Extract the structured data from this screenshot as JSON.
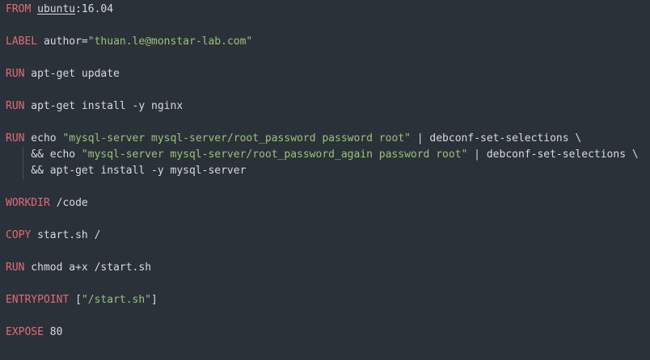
{
  "code": {
    "lines": [
      {
        "kw": "FROM",
        "image": "ubuntu",
        "tag": ":16.04"
      },
      {
        "kw": "LABEL",
        "key": " author=",
        "value": "\"thuan.le@monstar-lab.com\""
      },
      {
        "kw": "RUN",
        "text": " apt-get update"
      },
      {
        "kw": "RUN",
        "text": " apt-get install -y nginx"
      },
      {
        "kw": "RUN",
        "pre": " echo ",
        "str": "\"mysql-server mysql-server/root_password password root\"",
        "post": " | debconf-set-selections \\"
      },
      {
        "pre": "    && echo ",
        "str": "\"mysql-server mysql-server/root_password_again password root\"",
        "post": " | debconf-set-selections \\"
      },
      {
        "text": "    && apt-get install -y mysql-server"
      },
      {
        "kw": "WORKDIR",
        "text": " /code"
      },
      {
        "kw": "COPY",
        "text": " start.sh /"
      },
      {
        "kw": "RUN",
        "text": " chmod a+x /start.sh"
      },
      {
        "kw": "ENTRYPOINT",
        "pre": " [",
        "str": "\"/start.sh\"",
        "post": "]"
      },
      {
        "kw": "EXPOSE",
        "text": " 80"
      }
    ]
  }
}
